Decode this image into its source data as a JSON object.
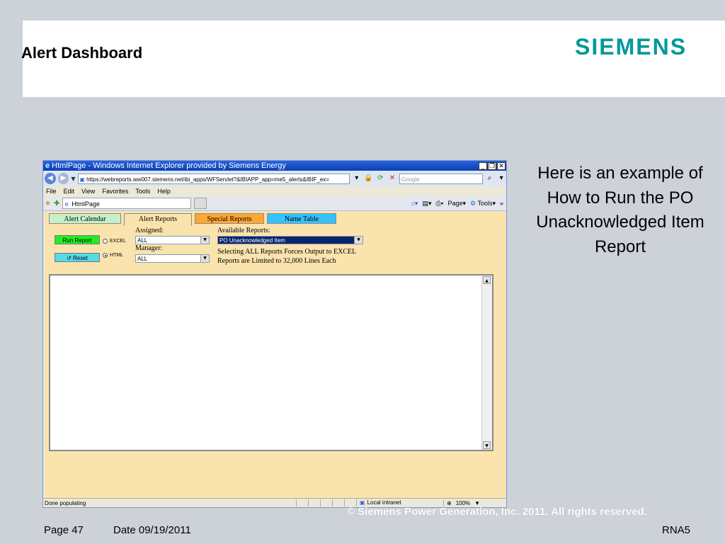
{
  "slide": {
    "title": "Alert Dashboard",
    "logo_text": "SIEMENS",
    "caption": "Here is an example of How to Run the PO Unacknowledged Item Report",
    "footer": {
      "page": "Page 47",
      "date": "Date 09/19/2011",
      "code": "RNA5",
      "copyright": "©  Siemens Power Generation, Inc. 2011. All rights reserved."
    },
    "colors": {
      "logo": "#009999",
      "background": "#cdd2d9"
    }
  },
  "browser": {
    "title": "HtmlPage - Windows Internet Explorer provided by Siemens Energy",
    "url": "https://webreports.ww007.siemens.net/ibi_apps/WFServlet?&IBIAPP_app=me5_alerts&IBIF_ex=",
    "search_placeholder": "Google",
    "menu": [
      "File",
      "Edit",
      "View",
      "Favorites",
      "Tools",
      "Help"
    ],
    "tab_title": "HtmlPage",
    "commands": {
      "page": "Page",
      "tools": "Tools"
    },
    "status_text": "Done populating",
    "zone": "Local intranet",
    "zoom": "100%"
  },
  "app": {
    "tabs": [
      "Alert Calendar",
      "Alert Reports",
      "Special Reports",
      "Name Table"
    ],
    "run_button": "Run Report",
    "reset_button": "Reset",
    "radio_excel": "EXCEL",
    "radio_html": "HTML",
    "assigned_label": "Assigned:",
    "assigned_value": "ALL",
    "manager_label": "Manager:",
    "manager_value": "ALL",
    "available_label": "Available Reports:",
    "available_value": "PO Unacknowledged Item",
    "note_line1": "Selecting ALL Reports Forces Output to EXCEL",
    "note_line2": "Reports are Limited to 32,000 Lines Each"
  }
}
